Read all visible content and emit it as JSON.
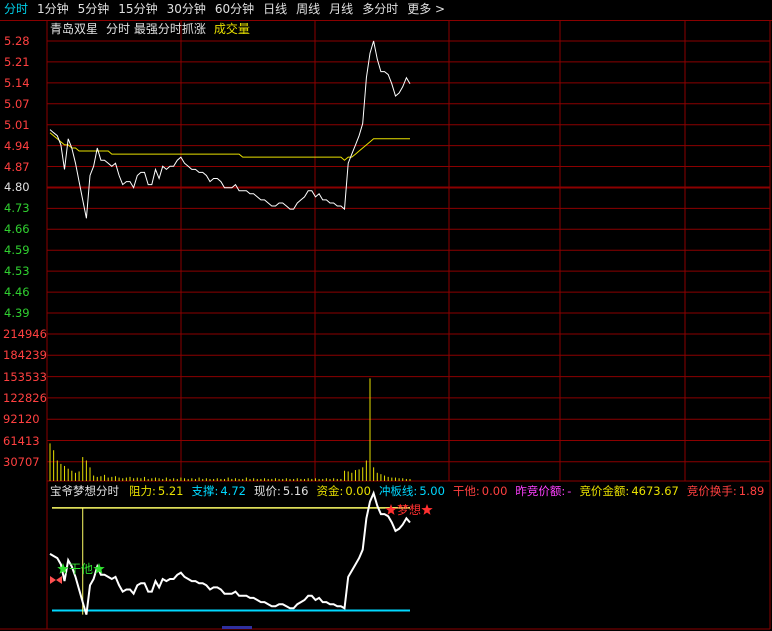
{
  "tabs": [
    {
      "label": "分时",
      "active": true
    },
    {
      "label": "1分钟"
    },
    {
      "label": "5分钟"
    },
    {
      "label": "15分钟"
    },
    {
      "label": "30分钟"
    },
    {
      "label": "60分钟"
    },
    {
      "label": "日线"
    },
    {
      "label": "周线"
    },
    {
      "label": "月线"
    },
    {
      "label": "多分时"
    },
    {
      "label": "更多 >"
    }
  ],
  "title": {
    "stock": "青岛双星",
    "mode": "分时 最强分时抓涨",
    "volume_label": "成交量"
  },
  "price_axis": {
    "labels": [
      "5.28",
      "5.21",
      "5.14",
      "5.07",
      "5.01",
      "4.94",
      "4.87",
      "4.80",
      "4.73",
      "4.66",
      "4.59",
      "4.53",
      "4.46",
      "4.39"
    ],
    "prev_close": 4.8,
    "up_color": "#ff4040",
    "down_color": "#30d030",
    "flat_color": "#e0e0e0"
  },
  "volume_axis": {
    "labels": [
      "214946",
      "184239",
      "153533",
      "122826",
      "92120",
      "61413",
      "30707"
    ],
    "color": "#e8e000"
  },
  "indicator": {
    "name": "宝爷梦想分时",
    "resistance_label": "阻力:",
    "resistance": "5.21",
    "support_label": "支撑:",
    "support": "4.72",
    "price_label": "现价:",
    "price": "5.16",
    "fund_label": "资金:",
    "fund": "0.00",
    "limit_label": "冲板线:",
    "limit": "5.00",
    "gan_label": "干他:",
    "gan": "0.00",
    "prev_bid_label": "昨竞价额:",
    "prev_bid": "-",
    "bid_amount_label": "竞价金额:",
    "bid_amount": "4673.67",
    "bid_turnover_label": "竞价换手:",
    "bid_turnover": "1.89",
    "marker_gan": "干他",
    "marker_dream": "梦想"
  },
  "chart_data": {
    "type": "line",
    "series": [
      {
        "name": "",
        "values": [
          4.99,
          4.98,
          4.97,
          4.94,
          4.86,
          4.96,
          4.93,
          4.88,
          4.82,
          4.76,
          4.7,
          4.84,
          4.87,
          4.93,
          4.89,
          4.89,
          4.88,
          4.87,
          4.88,
          4.84,
          4.81,
          4.82,
          4.82,
          4.8,
          4.84,
          4.85,
          4.85,
          4.81,
          4.81,
          4.86,
          4.83,
          4.87,
          4.86,
          4.87,
          4.87,
          4.89,
          4.9,
          4.88,
          4.87,
          4.86,
          4.86,
          4.85,
          4.85,
          4.84,
          4.82,
          4.83,
          4.83,
          4.82,
          4.8,
          4.8,
          4.8,
          4.81,
          4.79,
          4.79,
          4.79,
          4.78,
          4.78,
          4.77,
          4.76,
          4.76,
          4.75,
          4.74,
          4.74,
          4.75,
          4.75,
          4.74,
          4.73,
          4.73,
          4.75,
          4.76,
          4.77,
          4.79,
          4.79,
          4.77,
          4.78,
          4.76,
          4.76,
          4.75,
          4.75,
          4.74,
          4.74,
          4.73,
          4.88,
          4.91,
          4.94,
          4.97,
          5.01,
          5.16,
          5.24,
          5.28,
          5.22,
          5.18,
          5.18,
          5.17,
          5.14,
          5.1,
          5.11,
          5.13,
          5.16,
          5.14
        ]
      },
      {
        "name": "",
        "values": [
          4.98,
          4.97,
          4.96,
          4.95,
          4.94,
          4.94,
          4.93,
          4.93,
          4.92,
          4.92,
          4.92,
          4.92,
          4.92,
          4.92,
          4.92,
          4.92,
          4.92,
          4.91,
          4.91,
          4.91,
          4.91,
          4.91,
          4.91,
          4.91,
          4.91,
          4.91,
          4.91,
          4.91,
          4.91,
          4.91,
          4.91,
          4.91,
          4.91,
          4.91,
          4.91,
          4.91,
          4.91,
          4.91,
          4.91,
          4.91,
          4.91,
          4.91,
          4.91,
          4.91,
          4.91,
          4.91,
          4.91,
          4.91,
          4.91,
          4.91,
          4.91,
          4.91,
          4.91,
          4.9,
          4.9,
          4.9,
          4.9,
          4.9,
          4.9,
          4.9,
          4.9,
          4.9,
          4.9,
          4.9,
          4.9,
          4.9,
          4.9,
          4.9,
          4.9,
          4.9,
          4.9,
          4.9,
          4.9,
          4.9,
          4.9,
          4.9,
          4.9,
          4.9,
          4.9,
          4.9,
          4.9,
          4.89,
          4.9,
          4.9,
          4.91,
          4.92,
          4.93,
          4.94,
          4.95,
          4.96,
          4.96,
          4.96,
          4.96,
          4.96,
          4.96,
          4.96,
          4.96,
          4.96,
          4.96,
          4.96
        ]
      }
    ],
    "volume": [
      55000,
      45000,
      30000,
      25000,
      22000,
      18000,
      15000,
      12000,
      14000,
      35000,
      30000,
      20000,
      8000,
      6000,
      7000,
      9000,
      5000,
      6000,
      7000,
      5000,
      4000,
      5000,
      6000,
      4000,
      5000,
      4000,
      6000,
      3000,
      4000,
      5000,
      4000,
      3000,
      5000,
      3000,
      4000,
      3000,
      5000,
      4000,
      3000,
      4000,
      3000,
      5000,
      3000,
      4000,
      3000,
      3000,
      4000,
      3000,
      3000,
      5000,
      3000,
      4000,
      3000,
      3000,
      5000,
      3000,
      4000,
      3000,
      3000,
      4000,
      3000,
      3000,
      4000,
      3000,
      3000,
      4000,
      3000,
      3000,
      4000,
      3000,
      3000,
      4000,
      3000,
      4000,
      3000,
      3000,
      4000,
      3000,
      4000,
      3000,
      3000,
      15000,
      14000,
      12000,
      16000,
      17000,
      20000,
      30000,
      150000,
      20000,
      12000,
      10000,
      8000,
      6000,
      5000,
      5000,
      4000,
      4000,
      3000,
      3000
    ],
    "ylim_price": [
      4.39,
      5.28
    ],
    "ylim_volume": [
      0,
      214946
    ]
  },
  "colors": {
    "grid": "#8b0000",
    "price_line": "#ffffff",
    "avg_line": "#e8e000",
    "resistance_line": "#ffff66",
    "support_line": "#00d8ff"
  }
}
